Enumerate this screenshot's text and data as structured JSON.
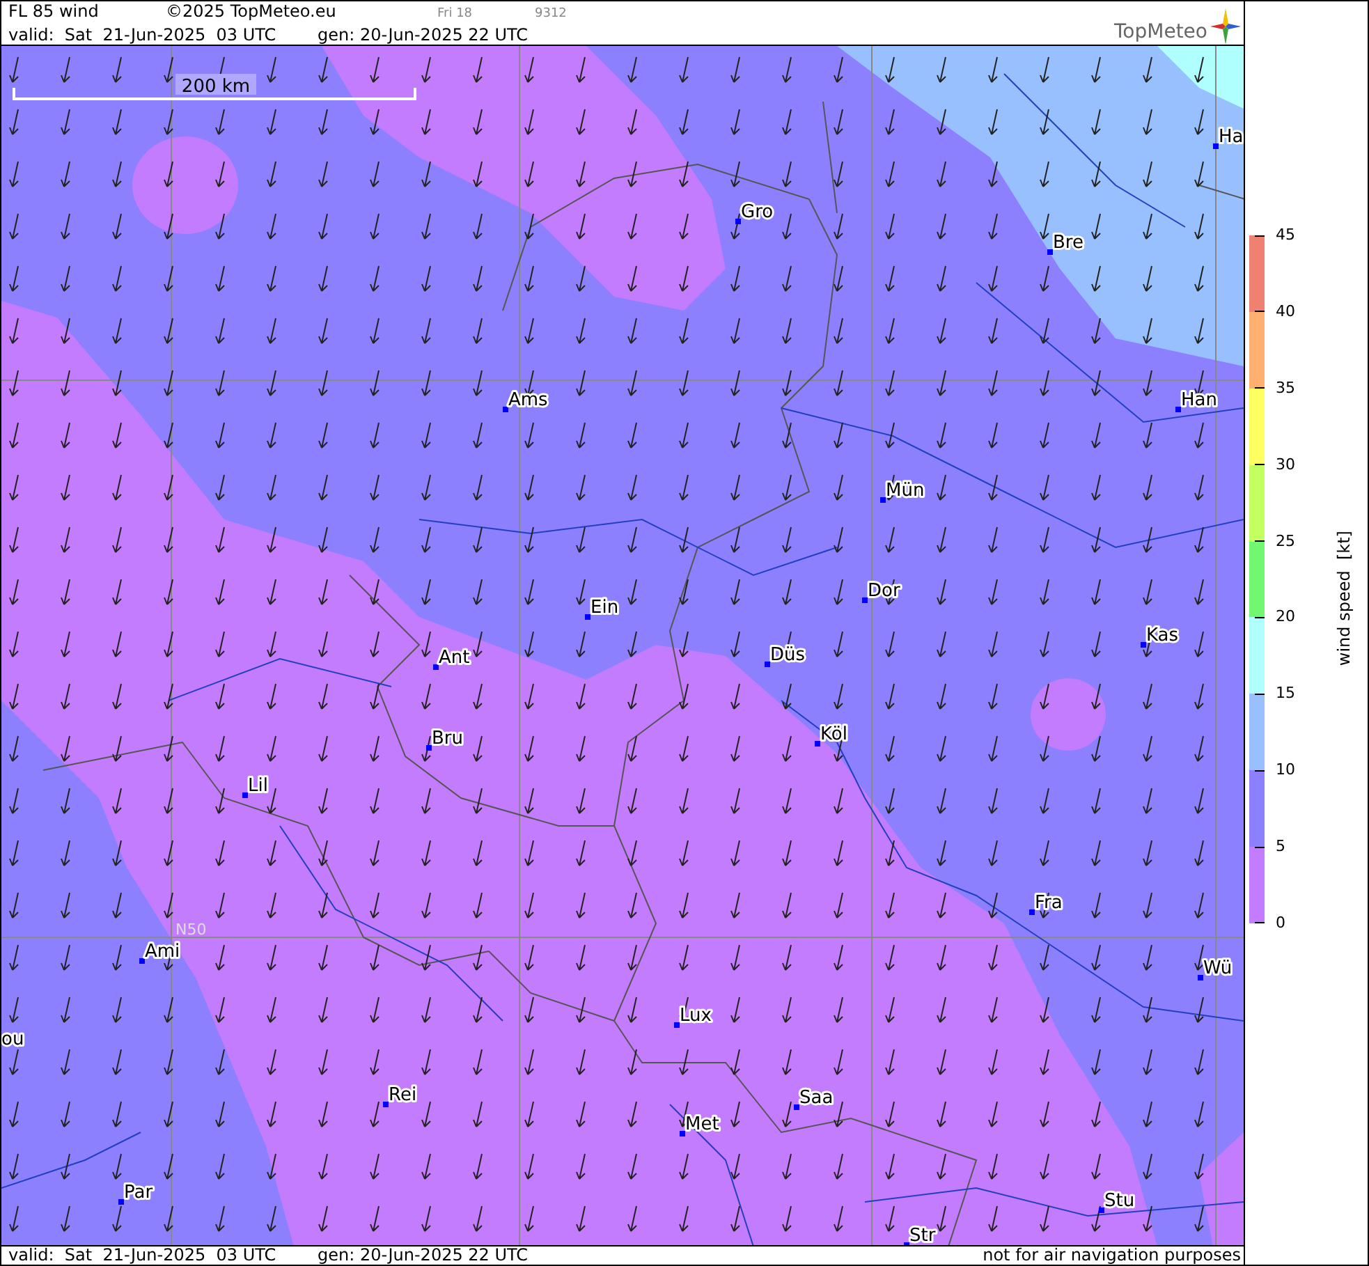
{
  "header": {
    "title": "FL 85 wind",
    "copyright": "©2025 TopMeteo.eu",
    "run_day": "Fri 18",
    "code": "9312",
    "valid": "valid:  Sat  21-Jun-2025  03 UTC",
    "generated": "gen: 20-Jun-2025 22 UTC",
    "logo": "TopMeteo"
  },
  "map": {
    "scale_label": "200 km",
    "latitude_label": "N50",
    "cities": [
      {
        "name": "Gro"
      },
      {
        "name": "Bre"
      },
      {
        "name": "Ha"
      },
      {
        "name": "Ams"
      },
      {
        "name": "Han"
      },
      {
        "name": "Mün"
      },
      {
        "name": "Ein"
      },
      {
        "name": "Dor"
      },
      {
        "name": "Kas"
      },
      {
        "name": "Ant"
      },
      {
        "name": "Düs"
      },
      {
        "name": "Bru"
      },
      {
        "name": "Köl"
      },
      {
        "name": "Lil"
      },
      {
        "name": "Fra"
      },
      {
        "name": "Ami"
      },
      {
        "name": "Wü"
      },
      {
        "name": "ou"
      },
      {
        "name": "Lux"
      },
      {
        "name": "Rei"
      },
      {
        "name": "Saa"
      },
      {
        "name": "Met"
      },
      {
        "name": "Par"
      },
      {
        "name": "Stu"
      },
      {
        "name": "Str"
      }
    ]
  },
  "legend": {
    "title": "wind speed  [kt]",
    "ticks": [
      "45",
      "40",
      "35",
      "30",
      "25",
      "20",
      "15",
      "10",
      "5",
      "0"
    ],
    "bands": [
      {
        "color": "#f08070"
      },
      {
        "color": "#ffb070"
      },
      {
        "color": "#ffff60"
      },
      {
        "color": "#c4ff60"
      },
      {
        "color": "#70f870"
      },
      {
        "color": "#b0ffff"
      },
      {
        "color": "#98c0ff"
      },
      {
        "color": "#8c80ff"
      },
      {
        "color": "#c47cff"
      }
    ]
  },
  "footer": {
    "valid": "valid:  Sat  21-Jun-2025  03 UTC",
    "generated": "gen: 20-Jun-2025 22 UTC",
    "notice": "not for air navigation purposes"
  }
}
